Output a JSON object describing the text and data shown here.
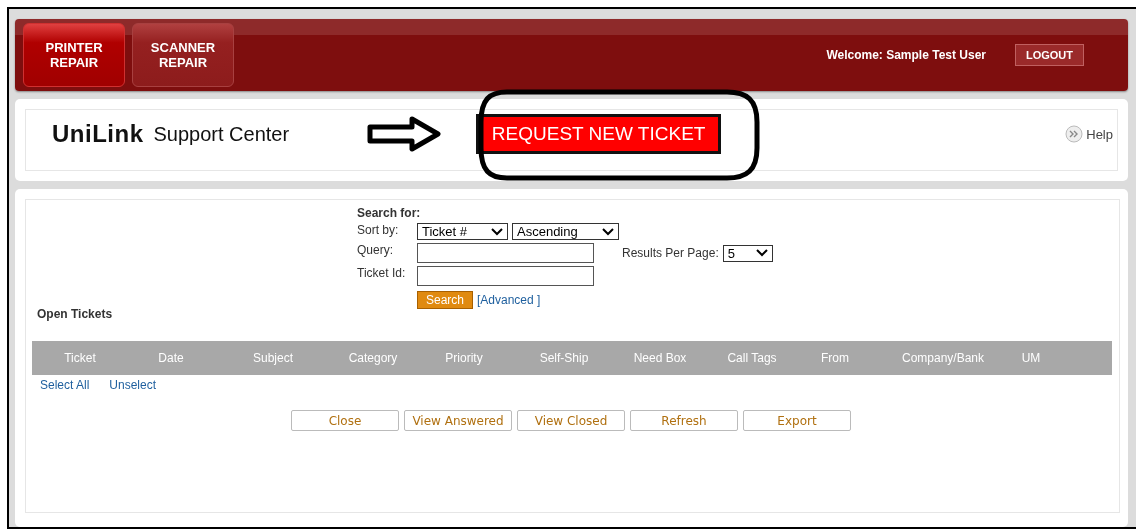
{
  "header": {
    "tabs": [
      {
        "label": "PRINTER\nREPAIR",
        "selected": true
      },
      {
        "label": "SCANNER\nREPAIR",
        "selected": false
      }
    ],
    "welcome": "Welcome: Sample Test User",
    "logout": "LOGOUT"
  },
  "title_bar": {
    "logo": "UniLink",
    "title": "Support Center",
    "request_button": "REQUEST NEW TICKET",
    "help": "Help"
  },
  "search": {
    "heading": "Search for:",
    "sort_label": "Sort by:",
    "sort_field": "Ticket #",
    "sort_order": "Ascending",
    "query_label": "Query:",
    "ticket_id_label": "Ticket Id:",
    "results_label": "Results Per Page:",
    "results_value": "5",
    "search_button": "Search",
    "advanced_link": "[Advanced ]"
  },
  "tickets": {
    "title": "Open Tickets",
    "columns": [
      "Ticket",
      "Date",
      "Subject",
      "Category",
      "Priority",
      "Self-Ship",
      "Need Box",
      "Call Tags",
      "From",
      "Company/Bank",
      "UM"
    ],
    "select_all": "Select All",
    "unselect": "Unselect",
    "buttons": [
      "Close",
      "View Answered",
      "View Closed",
      "Refresh",
      "Export"
    ]
  }
}
